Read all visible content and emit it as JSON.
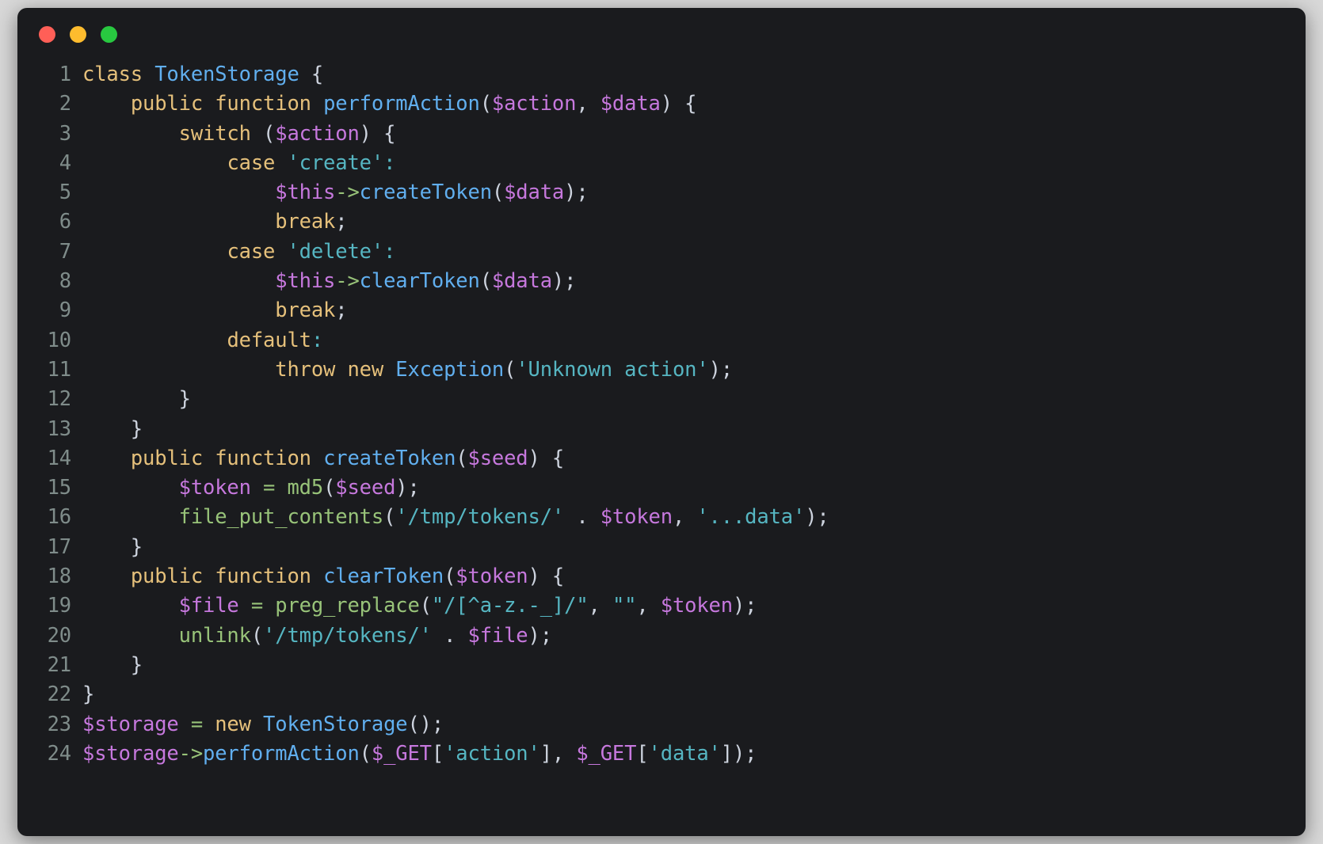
{
  "window": {
    "titlebar": {
      "buttons": [
        {
          "name": "close-button",
          "label": "close",
          "color": "#ff5f57"
        },
        {
          "name": "minimize-button",
          "label": "minimize",
          "color": "#febc2e"
        },
        {
          "name": "maximize-button",
          "label": "maximize",
          "color": "#28c840"
        }
      ]
    },
    "background": "#1a1b1e"
  },
  "editor": {
    "language": "php",
    "gutter_color": "#7f8c8a",
    "palette": {
      "keyword": "#e5c07b",
      "class_or_function": "#61afef",
      "variable": "#c678dd",
      "string": "#56b6c2",
      "builtin": "#98c379",
      "punctuation": "#cdd3de"
    },
    "line_numbers": [
      1,
      2,
      3,
      4,
      5,
      6,
      7,
      8,
      9,
      10,
      11,
      12,
      13,
      14,
      15,
      16,
      17,
      18,
      19,
      20,
      21,
      22,
      23,
      24
    ],
    "lines": [
      {
        "n": 1,
        "text": "class TokenStorage {",
        "tokens": [
          {
            "t": "class",
            "c": "t-def"
          },
          {
            "t": " ",
            "c": "t-pun"
          },
          {
            "t": "TokenStorage",
            "c": "t-cls"
          },
          {
            "t": " {",
            "c": "t-pun"
          }
        ]
      },
      {
        "n": 2,
        "text": "    public function performAction($action, $data) {",
        "tokens": [
          {
            "t": "    ",
            "c": "t-pun"
          },
          {
            "t": "public function",
            "c": "t-def"
          },
          {
            "t": " ",
            "c": "t-pun"
          },
          {
            "t": "performAction",
            "c": "t-cls"
          },
          {
            "t": "(",
            "c": "t-pun"
          },
          {
            "t": "$action",
            "c": "t-var"
          },
          {
            "t": ", ",
            "c": "t-pun"
          },
          {
            "t": "$data",
            "c": "t-var"
          },
          {
            "t": ") {",
            "c": "t-pun"
          }
        ]
      },
      {
        "n": 3,
        "text": "        switch ($action) {",
        "tokens": [
          {
            "t": "        ",
            "c": "t-pun"
          },
          {
            "t": "switch",
            "c": "t-def"
          },
          {
            "t": " (",
            "c": "t-pun"
          },
          {
            "t": "$action",
            "c": "t-var"
          },
          {
            "t": ") {",
            "c": "t-pun"
          }
        ]
      },
      {
        "n": 4,
        "text": "            case 'create':",
        "tokens": [
          {
            "t": "            ",
            "c": "t-pun"
          },
          {
            "t": "case",
            "c": "t-def"
          },
          {
            "t": " ",
            "c": "t-pun"
          },
          {
            "t": "'create'",
            "c": "t-str"
          },
          {
            "t": ":",
            "c": "t-str"
          }
        ]
      },
      {
        "n": 5,
        "text": "                $this->createToken($data);",
        "tokens": [
          {
            "t": "                ",
            "c": "t-pun"
          },
          {
            "t": "$this",
            "c": "t-var"
          },
          {
            "t": "->",
            "c": "t-bi"
          },
          {
            "t": "createToken",
            "c": "t-cls"
          },
          {
            "t": "(",
            "c": "t-pun"
          },
          {
            "t": "$data",
            "c": "t-var"
          },
          {
            "t": ");",
            "c": "t-pun"
          }
        ]
      },
      {
        "n": 6,
        "text": "                break;",
        "tokens": [
          {
            "t": "                ",
            "c": "t-pun"
          },
          {
            "t": "break",
            "c": "t-def"
          },
          {
            "t": ";",
            "c": "t-pun"
          }
        ]
      },
      {
        "n": 7,
        "text": "            case 'delete':",
        "tokens": [
          {
            "t": "            ",
            "c": "t-pun"
          },
          {
            "t": "case",
            "c": "t-def"
          },
          {
            "t": " ",
            "c": "t-pun"
          },
          {
            "t": "'delete'",
            "c": "t-str"
          },
          {
            "t": ":",
            "c": "t-str"
          }
        ]
      },
      {
        "n": 8,
        "text": "                $this->clearToken($data);",
        "tokens": [
          {
            "t": "                ",
            "c": "t-pun"
          },
          {
            "t": "$this",
            "c": "t-var"
          },
          {
            "t": "->",
            "c": "t-bi"
          },
          {
            "t": "clearToken",
            "c": "t-cls"
          },
          {
            "t": "(",
            "c": "t-pun"
          },
          {
            "t": "$data",
            "c": "t-var"
          },
          {
            "t": ");",
            "c": "t-pun"
          }
        ]
      },
      {
        "n": 9,
        "text": "                break;",
        "tokens": [
          {
            "t": "                ",
            "c": "t-pun"
          },
          {
            "t": "break",
            "c": "t-def"
          },
          {
            "t": ";",
            "c": "t-pun"
          }
        ]
      },
      {
        "n": 10,
        "text": "            default:",
        "tokens": [
          {
            "t": "            ",
            "c": "t-pun"
          },
          {
            "t": "default",
            "c": "t-def"
          },
          {
            "t": ":",
            "c": "t-str"
          }
        ]
      },
      {
        "n": 11,
        "text": "                throw new Exception('Unknown action');",
        "tokens": [
          {
            "t": "                ",
            "c": "t-pun"
          },
          {
            "t": "throw new",
            "c": "t-def"
          },
          {
            "t": " ",
            "c": "t-pun"
          },
          {
            "t": "Exception",
            "c": "t-cls"
          },
          {
            "t": "(",
            "c": "t-pun"
          },
          {
            "t": "'Unknown action'",
            "c": "t-str"
          },
          {
            "t": ");",
            "c": "t-pun"
          }
        ]
      },
      {
        "n": 12,
        "text": "        }",
        "tokens": [
          {
            "t": "        }",
            "c": "t-pun"
          }
        ]
      },
      {
        "n": 13,
        "text": "    }",
        "tokens": [
          {
            "t": "    }",
            "c": "t-pun"
          }
        ]
      },
      {
        "n": 14,
        "text": "    public function createToken($seed) {",
        "tokens": [
          {
            "t": "    ",
            "c": "t-pun"
          },
          {
            "t": "public function",
            "c": "t-def"
          },
          {
            "t": " ",
            "c": "t-pun"
          },
          {
            "t": "createToken",
            "c": "t-cls"
          },
          {
            "t": "(",
            "c": "t-pun"
          },
          {
            "t": "$seed",
            "c": "t-var"
          },
          {
            "t": ") {",
            "c": "t-pun"
          }
        ]
      },
      {
        "n": 15,
        "text": "        $token = md5($seed);",
        "tokens": [
          {
            "t": "        ",
            "c": "t-pun"
          },
          {
            "t": "$token",
            "c": "t-var"
          },
          {
            "t": " ",
            "c": "t-pun"
          },
          {
            "t": "=",
            "c": "t-bi"
          },
          {
            "t": " ",
            "c": "t-pun"
          },
          {
            "t": "md5",
            "c": "t-bi"
          },
          {
            "t": "(",
            "c": "t-pun"
          },
          {
            "t": "$seed",
            "c": "t-var"
          },
          {
            "t": ");",
            "c": "t-pun"
          }
        ]
      },
      {
        "n": 16,
        "text": "        file_put_contents('/tmp/tokens/' . $token, '...data');",
        "tokens": [
          {
            "t": "        ",
            "c": "t-pun"
          },
          {
            "t": "file_put_contents",
            "c": "t-bi"
          },
          {
            "t": "(",
            "c": "t-pun"
          },
          {
            "t": "'/tmp/tokens/'",
            "c": "t-str"
          },
          {
            "t": " . ",
            "c": "t-pun"
          },
          {
            "t": "$token",
            "c": "t-var"
          },
          {
            "t": ", ",
            "c": "t-pun"
          },
          {
            "t": "'...data'",
            "c": "t-str"
          },
          {
            "t": ");",
            "c": "t-pun"
          }
        ]
      },
      {
        "n": 17,
        "text": "    }",
        "tokens": [
          {
            "t": "    }",
            "c": "t-pun"
          }
        ]
      },
      {
        "n": 18,
        "text": "    public function clearToken($token) {",
        "tokens": [
          {
            "t": "    ",
            "c": "t-pun"
          },
          {
            "t": "public function",
            "c": "t-def"
          },
          {
            "t": " ",
            "c": "t-pun"
          },
          {
            "t": "clearToken",
            "c": "t-cls"
          },
          {
            "t": "(",
            "c": "t-pun"
          },
          {
            "t": "$token",
            "c": "t-var"
          },
          {
            "t": ") {",
            "c": "t-pun"
          }
        ]
      },
      {
        "n": 19,
        "text": "        $file = preg_replace(\"/[^a-z.-_]/\", \"\", $token);",
        "tokens": [
          {
            "t": "        ",
            "c": "t-pun"
          },
          {
            "t": "$file",
            "c": "t-var"
          },
          {
            "t": " ",
            "c": "t-pun"
          },
          {
            "t": "=",
            "c": "t-bi"
          },
          {
            "t": " ",
            "c": "t-pun"
          },
          {
            "t": "preg_replace",
            "c": "t-bi"
          },
          {
            "t": "(",
            "c": "t-pun"
          },
          {
            "t": "\"/[^a-z.-_]/\"",
            "c": "t-str"
          },
          {
            "t": ", ",
            "c": "t-pun"
          },
          {
            "t": "\"\"",
            "c": "t-str"
          },
          {
            "t": ", ",
            "c": "t-pun"
          },
          {
            "t": "$token",
            "c": "t-var"
          },
          {
            "t": ");",
            "c": "t-pun"
          }
        ]
      },
      {
        "n": 20,
        "text": "        unlink('/tmp/tokens/' . $file);",
        "tokens": [
          {
            "t": "        ",
            "c": "t-pun"
          },
          {
            "t": "unlink",
            "c": "t-bi"
          },
          {
            "t": "(",
            "c": "t-pun"
          },
          {
            "t": "'/tmp/tokens/'",
            "c": "t-str"
          },
          {
            "t": " . ",
            "c": "t-pun"
          },
          {
            "t": "$file",
            "c": "t-var"
          },
          {
            "t": ");",
            "c": "t-pun"
          }
        ]
      },
      {
        "n": 21,
        "text": "    }",
        "tokens": [
          {
            "t": "    }",
            "c": "t-pun"
          }
        ]
      },
      {
        "n": 22,
        "text": "}",
        "tokens": [
          {
            "t": "}",
            "c": "t-pun"
          }
        ]
      },
      {
        "n": 23,
        "text": "$storage = new TokenStorage();",
        "tokens": [
          {
            "t": "$storage",
            "c": "t-var"
          },
          {
            "t": " ",
            "c": "t-pun"
          },
          {
            "t": "=",
            "c": "t-bi"
          },
          {
            "t": " ",
            "c": "t-pun"
          },
          {
            "t": "new",
            "c": "t-def"
          },
          {
            "t": " ",
            "c": "t-pun"
          },
          {
            "t": "TokenStorage",
            "c": "t-cls"
          },
          {
            "t": "();",
            "c": "t-pun"
          }
        ]
      },
      {
        "n": 24,
        "text": "$storage->performAction($_GET['action'], $_GET['data']);",
        "tokens": [
          {
            "t": "$storage",
            "c": "t-var"
          },
          {
            "t": "->",
            "c": "t-bi"
          },
          {
            "t": "performAction",
            "c": "t-cls"
          },
          {
            "t": "(",
            "c": "t-pun"
          },
          {
            "t": "$_GET",
            "c": "t-var"
          },
          {
            "t": "[",
            "c": "t-pun"
          },
          {
            "t": "'action'",
            "c": "t-str"
          },
          {
            "t": "], ",
            "c": "t-pun"
          },
          {
            "t": "$_GET",
            "c": "t-var"
          },
          {
            "t": "[",
            "c": "t-pun"
          },
          {
            "t": "'data'",
            "c": "t-str"
          },
          {
            "t": "]);",
            "c": "t-pun"
          }
        ]
      }
    ]
  }
}
